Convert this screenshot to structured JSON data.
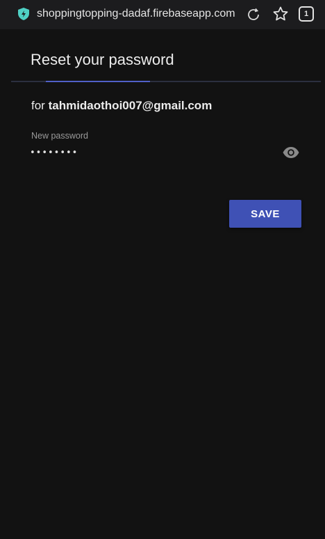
{
  "browser": {
    "url": "shoppingtopping-dadaf.firebaseapp.com",
    "tab_count": "1",
    "icons": [
      "shield-icon",
      "reload-icon",
      "star-icon",
      "tabs-icon"
    ]
  },
  "page": {
    "title": "Reset your password",
    "for_prefix": "for",
    "email": "tahmidaothoi007@gmail.com",
    "field_label": "New password",
    "password_value": "••••••••",
    "save_label": "SAVE",
    "visibility_icon": "eye-icon"
  },
  "colors": {
    "accent": "#3f51b5",
    "background": "#121212",
    "toolbar": "#1c1c1e"
  }
}
